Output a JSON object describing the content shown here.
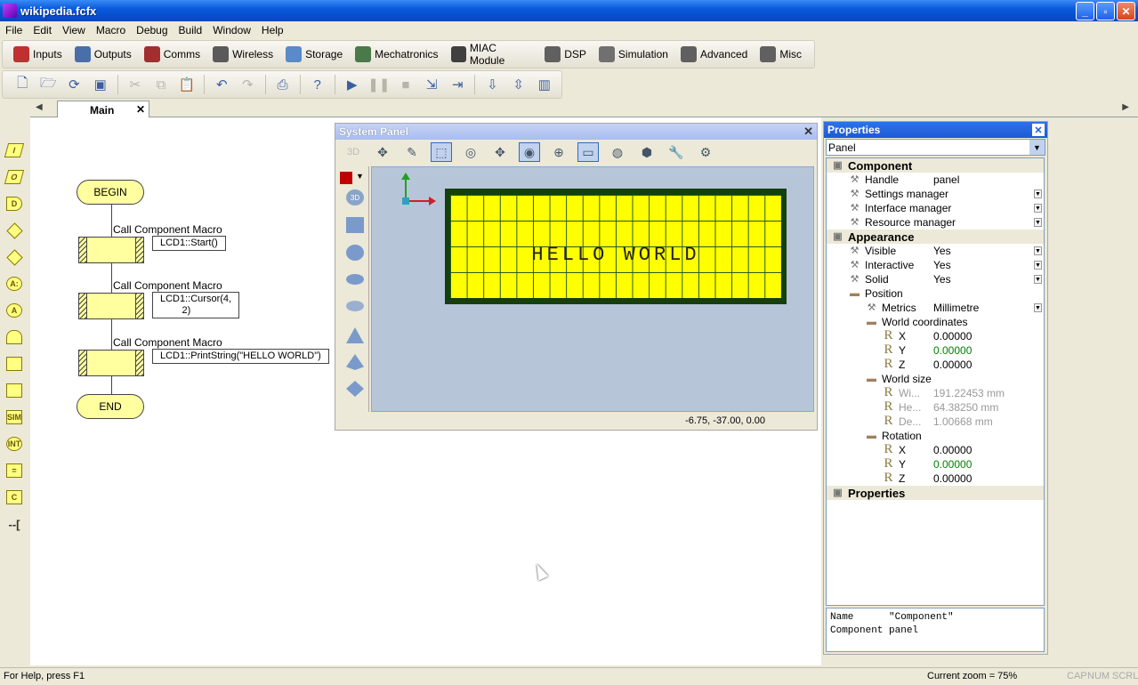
{
  "window": {
    "title": "wikipedia.fcfx"
  },
  "menu": [
    "File",
    "Edit",
    "View",
    "Macro",
    "Debug",
    "Build",
    "Window",
    "Help"
  ],
  "component_toolbar": [
    {
      "label": "Inputs",
      "icon": "inputs-icon",
      "color": "#c03030"
    },
    {
      "label": "Outputs",
      "icon": "outputs-icon",
      "color": "#4a6fa8"
    },
    {
      "label": "Comms",
      "icon": "comms-icon",
      "color": "#a03030"
    },
    {
      "label": "Wireless",
      "icon": "wireless-icon",
      "color": "#5a5a5a"
    },
    {
      "label": "Storage",
      "icon": "storage-icon",
      "color": "#5a8ac8"
    },
    {
      "label": "Mechatronics",
      "icon": "mechatronics-icon",
      "color": "#4a7a4a"
    },
    {
      "label": "MIAC Module",
      "icon": "miac-icon",
      "color": "#404040"
    },
    {
      "label": "DSP",
      "icon": "dsp-icon",
      "color": "#606060"
    },
    {
      "label": "Simulation",
      "icon": "simulation-icon",
      "color": "#707070"
    },
    {
      "label": "Advanced",
      "icon": "advanced-icon",
      "color": "#606060"
    },
    {
      "label": "Misc",
      "icon": "misc-icon",
      "color": "#606060"
    }
  ],
  "tabs": {
    "main_label": "Main"
  },
  "flowchart": {
    "begin": "BEGIN",
    "end": "END",
    "blocks": [
      {
        "title": "Call Component Macro",
        "callout": "LCD1::Start()"
      },
      {
        "title": "Call Component Macro",
        "callout": "LCD1::Cursor(4,\n        2)"
      },
      {
        "title": "Call Component Macro",
        "callout": "LCD1::PrintString(\"HELLO WORLD\")"
      }
    ]
  },
  "system_panel": {
    "title": "System Panel",
    "mode_label": "3D",
    "lcd_text": "HELLO WORLD",
    "coords": "-6.75, -37.00, 0.00"
  },
  "properties": {
    "title": "Properties",
    "selected": "Panel",
    "rows": [
      {
        "type": "cat",
        "name": "Component",
        "indent": 0
      },
      {
        "type": "prop",
        "name": "Handle",
        "value": "panel",
        "indent": 1
      },
      {
        "type": "prop",
        "name": "Settings manager",
        "value": "",
        "indent": 1,
        "drop": true
      },
      {
        "type": "prop",
        "name": "Interface manager",
        "value": "",
        "indent": 1,
        "drop": true
      },
      {
        "type": "prop",
        "name": "Resource manager",
        "value": "",
        "indent": 1,
        "drop": true
      },
      {
        "type": "cat",
        "name": "Appearance",
        "indent": 0
      },
      {
        "type": "prop",
        "name": "Visible",
        "value": "Yes",
        "indent": 1,
        "drop": true
      },
      {
        "type": "prop",
        "name": "Interactive",
        "value": "Yes",
        "indent": 1,
        "drop": true
      },
      {
        "type": "prop",
        "name": "Solid",
        "value": "Yes",
        "indent": 1,
        "drop": true
      },
      {
        "type": "folder",
        "name": "Position",
        "indent": 1
      },
      {
        "type": "prop",
        "name": "Metrics",
        "value": "Millimetre",
        "indent": 2,
        "drop": true
      },
      {
        "type": "folder",
        "name": "World coordinates",
        "indent": 2
      },
      {
        "type": "coord",
        "name": "X",
        "value": "0.00000",
        "indent": 3
      },
      {
        "type": "coord",
        "name": "Y",
        "value": "0.00000",
        "indent": 3,
        "green": true
      },
      {
        "type": "coord",
        "name": "Z",
        "value": "0.00000",
        "indent": 3
      },
      {
        "type": "folder",
        "name": "World size",
        "indent": 2
      },
      {
        "type": "coord",
        "name": "Wi...",
        "value": "191.22453 mm",
        "indent": 3,
        "grey": true
      },
      {
        "type": "coord",
        "name": "He...",
        "value": "64.38250 mm",
        "indent": 3,
        "grey": true
      },
      {
        "type": "coord",
        "name": "De...",
        "value": "1.00668 mm",
        "indent": 3,
        "grey": true
      },
      {
        "type": "folder",
        "name": "Rotation",
        "indent": 2
      },
      {
        "type": "coord",
        "name": "X",
        "value": "0.00000",
        "indent": 3
      },
      {
        "type": "coord",
        "name": "Y",
        "value": "0.00000",
        "indent": 3,
        "green": true
      },
      {
        "type": "coord",
        "name": "Z",
        "value": "0.00000",
        "indent": 3
      },
      {
        "type": "cat",
        "name": "Properties",
        "indent": 0
      }
    ],
    "description_line1": "Name      \"Component\"",
    "description_line2": "Component panel"
  },
  "status": {
    "help": "For Help, press F1",
    "zoom": "Current zoom = 75%",
    "cap": "CAP",
    "num": "NUM",
    "scrl": "SCRL"
  }
}
